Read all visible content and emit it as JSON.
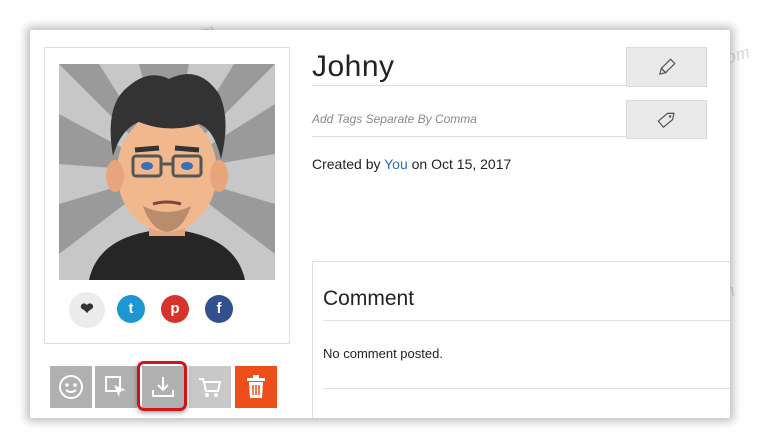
{
  "profile": {
    "name": "Johny",
    "tags_placeholder": "Add Tags Separate By Comma",
    "created_prefix": "Created by",
    "created_by": "You",
    "created_on_prefix": "on",
    "created_date": "Oct 15, 2017"
  },
  "social": {
    "like_icon": "heart-icon",
    "twitter_glyph": "t",
    "pinterest_glyph": "p",
    "facebook_glyph": "f"
  },
  "comments": {
    "title": "Comment",
    "empty_text": "No comment posted."
  },
  "actions": [
    {
      "icon": "avatar-face-icon"
    },
    {
      "icon": "select-cursor-icon"
    },
    {
      "icon": "download-icon",
      "highlighted": true
    },
    {
      "icon": "cart-icon"
    },
    {
      "icon": "trash-icon"
    }
  ],
  "colors": {
    "link": "#2d6bb4",
    "twitter": "#1d96d2",
    "pinterest": "#d6342a",
    "facebook": "#32508e",
    "delete": "#ee4f1a",
    "highlight": "#d1141c"
  },
  "watermark": "Soringpcrepair.com"
}
